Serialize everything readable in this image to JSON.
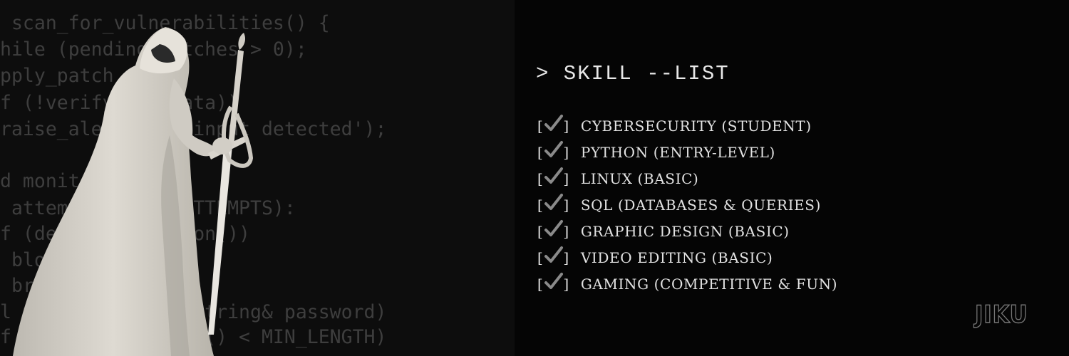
{
  "code_background": [
    " scan_for_vulnerabilities() {",
    "hile (pending_patches > 0);",
    "pply_patch",
    "f (!verify_user_ata))",
    "raise_alert('bad input detected');",
    "",
    "d monitor",
    " attempts < MAX_ATTEMPTS):",
    "f (detect_intrusion())",
    " block",
    " break",
    "l validate(const string& password)",
    "f (password.length() < MIN_LENGTH)"
  ],
  "figure": {
    "icon": "hooded-knight-with-sword"
  },
  "title": "> SKILL --LIST",
  "skills": [
    {
      "open": "[",
      "close": "]",
      "icon": "checkmark-icon",
      "label": "CYBERSECURITY (STUDENT)"
    },
    {
      "open": "[",
      "close": "]",
      "icon": "checkmark-icon",
      "label": "PYTHON (ENTRY-LEVEL)"
    },
    {
      "open": "[",
      "close": "]",
      "icon": "checkmark-icon",
      "label": "LINUX (BASIC)"
    },
    {
      "open": "[",
      "close": "]",
      "icon": "checkmark-icon",
      "label": "SQL (DATABASES & QUERIES)"
    },
    {
      "open": "[",
      "close": "]",
      "icon": "checkmark-icon",
      "label": "GRAPHIC DESIGN (BASIC)"
    },
    {
      "open": "[",
      "close": "]",
      "icon": "checkmark-icon",
      "label": "VIDEO EDITING (BASIC)"
    },
    {
      "open": "[",
      "close": "]",
      "icon": "checkmark-icon",
      "label": "GAMING (COMPETITIVE & FUN)"
    }
  ],
  "logo": "JIKU",
  "colors": {
    "background": "#050505",
    "left_panel": "#0d0d0d",
    "code_text": "#3e3e3e",
    "text": "#e2e2e2",
    "check": "#8a8a8a",
    "figure": "#d9d6cf"
  }
}
